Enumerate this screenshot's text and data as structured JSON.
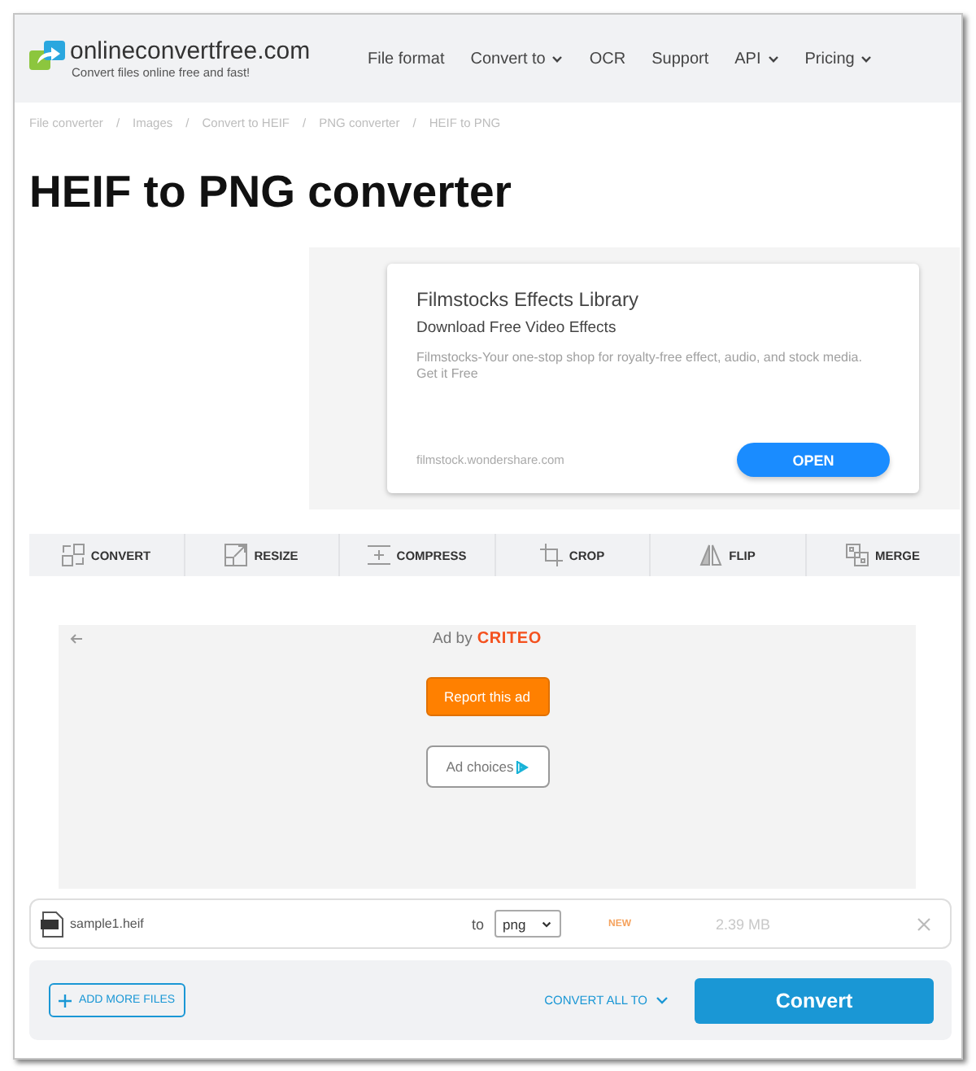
{
  "header": {
    "logo": {
      "name": "onlineconvertfree.com",
      "tagline": "Convert files online free and fast!"
    },
    "nav": [
      {
        "label": "File format",
        "dropdown": false
      },
      {
        "label": "Convert to",
        "dropdown": true
      },
      {
        "label": "OCR",
        "dropdown": false
      },
      {
        "label": "Support",
        "dropdown": false
      },
      {
        "label": "API",
        "dropdown": true
      },
      {
        "label": "Pricing",
        "dropdown": true
      }
    ]
  },
  "breadcrumb": [
    {
      "label": "File converter",
      "separator": "/"
    },
    {
      "label": "Images",
      "separator": "/"
    },
    {
      "label": "Convert to HEIF",
      "separator": "/"
    },
    {
      "label": "PNG converter",
      "separator": "/"
    },
    {
      "label": "HEIF to PNG"
    }
  ],
  "title": "HEIF to PNG converter",
  "ad_banner": {
    "headline": "Filmstocks Effects Library",
    "subheadline": "Download Free Video Effects",
    "description": "Filmstocks-Your one-stop shop for royalty-free effect, audio, and stock media. Get it Free",
    "domain": "filmstock.wondershare.com",
    "button": "OPEN"
  },
  "tools": [
    {
      "label": "CONVERT",
      "kind": "convert"
    },
    {
      "label": "RESIZE",
      "kind": "resize"
    },
    {
      "label": "COMPRESS",
      "kind": "compress"
    },
    {
      "label": "CROP",
      "kind": "crop"
    },
    {
      "label": "FLIP",
      "kind": "flip"
    },
    {
      "label": "MERGE",
      "kind": "merge"
    }
  ],
  "ad_block": {
    "attribution": "Ad by",
    "brand": "CRITEO",
    "report_button": "Report this ad",
    "choices_button": "Ad choices"
  },
  "files": [
    {
      "name": "sample1.heif",
      "to_label": "to",
      "format": "png",
      "badge": "NEW",
      "size": "2.39 MB"
    }
  ],
  "actions": {
    "add_button": "ADD MORE FILES",
    "convert_all": "CONVERT ALL TO",
    "convert_button": "Convert"
  }
}
